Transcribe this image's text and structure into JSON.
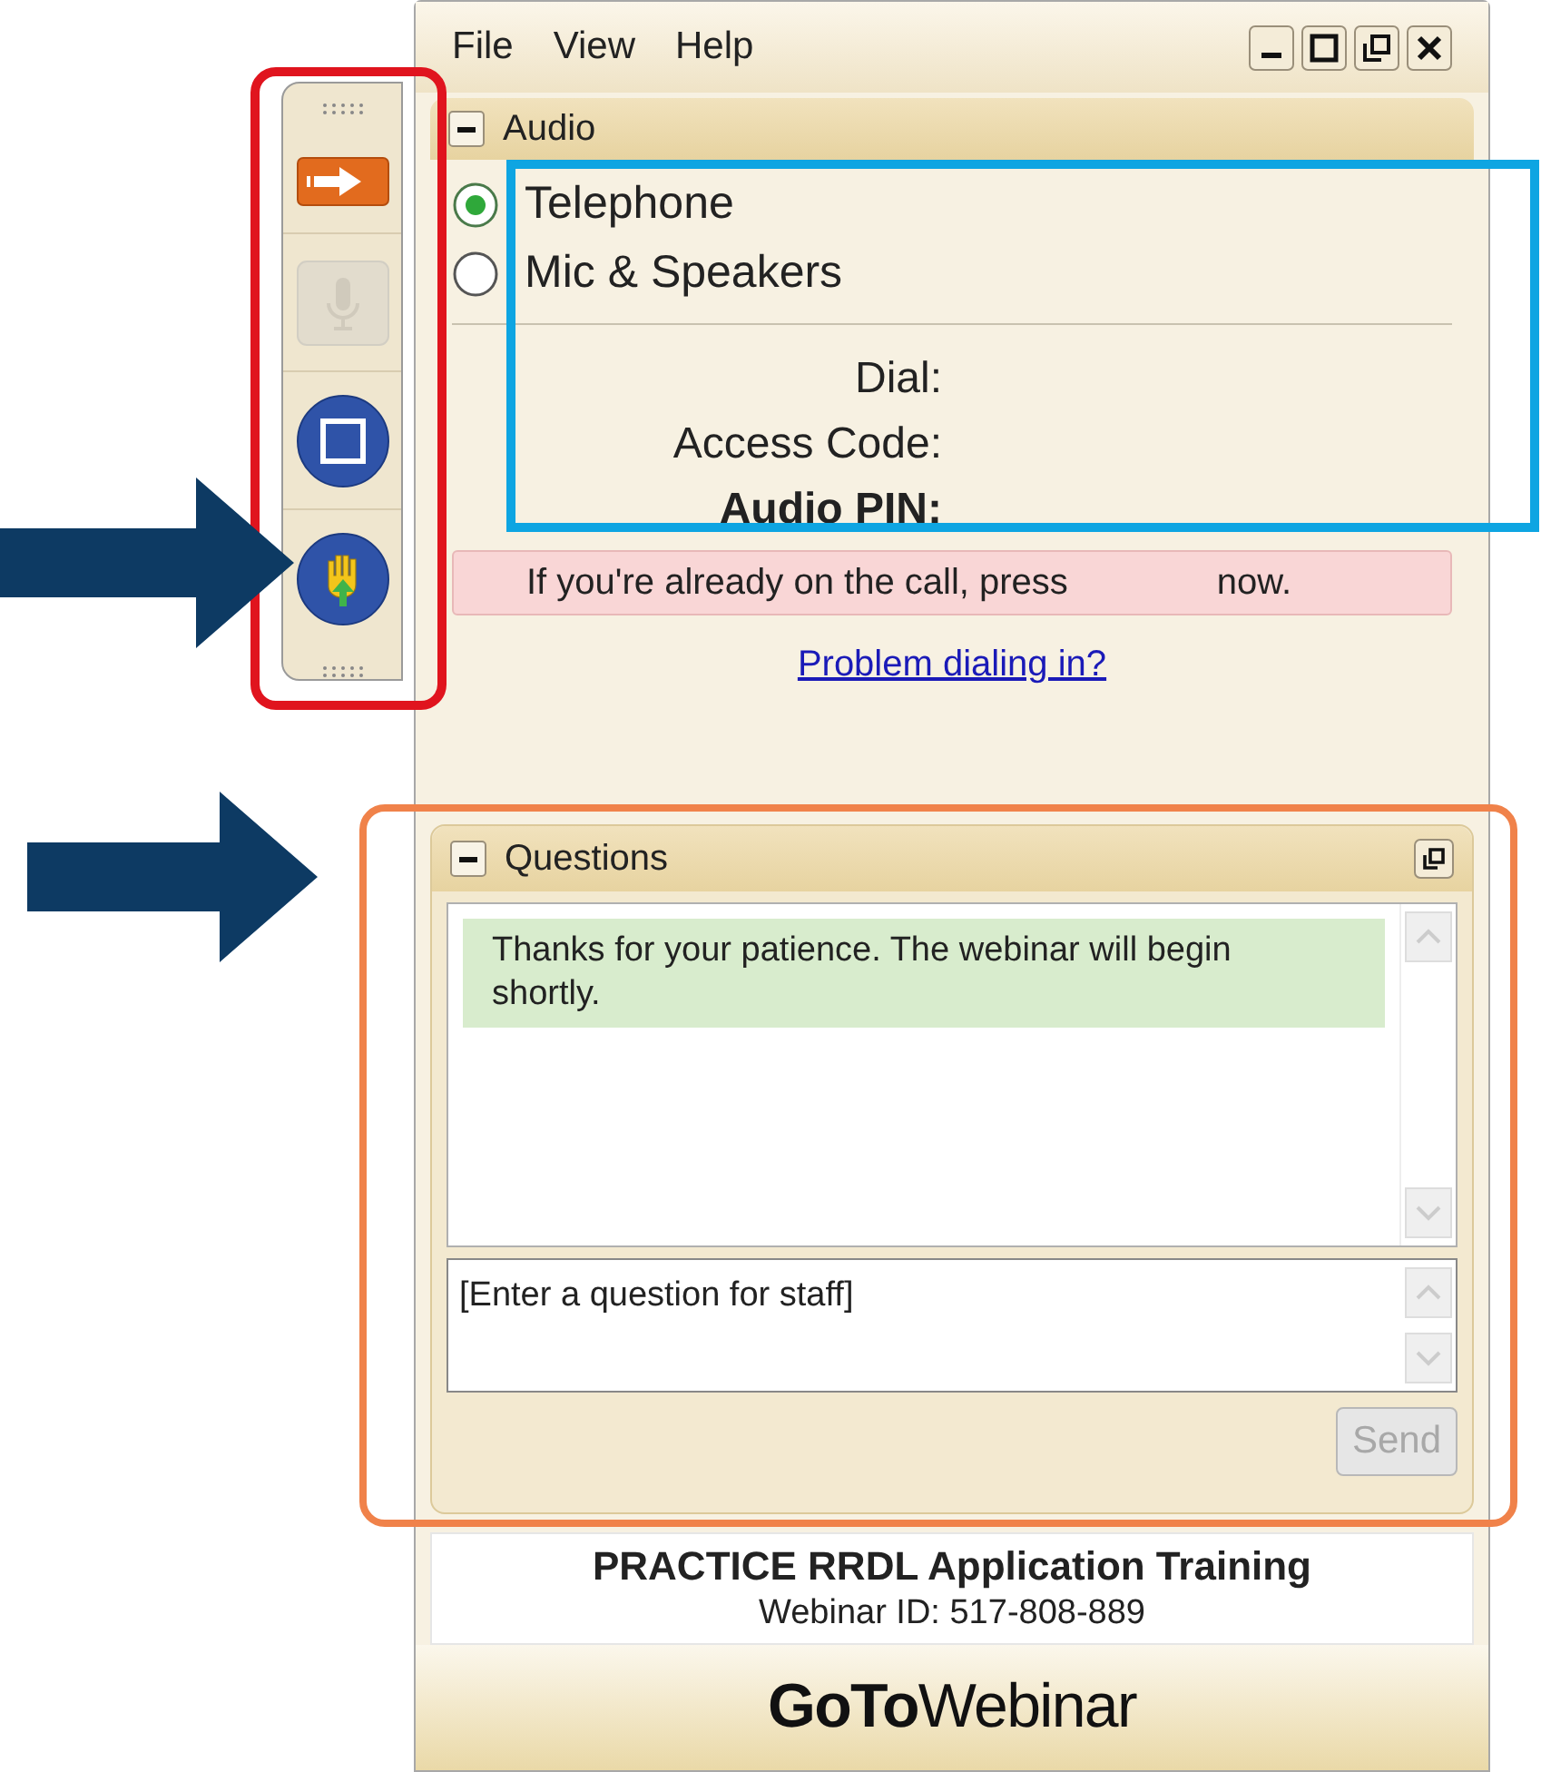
{
  "menu": [
    {
      "label": "File"
    },
    {
      "label": "View"
    },
    {
      "label": "Help"
    }
  ],
  "toolbar": [
    {
      "kind": "arrow",
      "disabled": false
    },
    {
      "kind": "mic",
      "disabled": true
    },
    {
      "kind": "screen",
      "disabled": false
    },
    {
      "kind": "hand",
      "disabled": false
    }
  ],
  "audio": {
    "title": "Audio",
    "options": [
      {
        "label": "Telephone",
        "selected": true
      },
      {
        "label": "Mic & Speakers",
        "selected": false
      }
    ],
    "fields": [
      {
        "label": "Dial:",
        "bold": false
      },
      {
        "label": "Access Code:",
        "bold": false
      },
      {
        "label": "Audio PIN:",
        "bold": true
      }
    ],
    "notice": [
      "If you're already on the call, press",
      "now."
    ],
    "link": "Problem dialing in?"
  },
  "questions": {
    "title": "Questions",
    "messages": [
      {
        "text": "Thanks for your patience.  The webinar will begin shortly."
      }
    ],
    "input": {
      "placeholder": "[Enter a question for staff]"
    },
    "send": {
      "label": "Send",
      "disabled": true
    }
  },
  "footer": {
    "title": "PRACTICE RRDL Application Training",
    "webinar_id": "Webinar ID: 517-808-889",
    "logo": "**GoTo**Webinar"
  }
}
